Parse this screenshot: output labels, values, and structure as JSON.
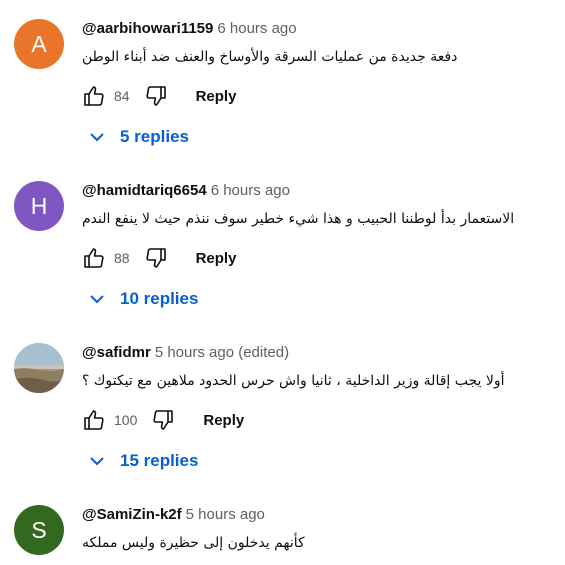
{
  "comments": [
    {
      "avatar_letter": "A",
      "avatar_color": "#e8752a",
      "author": "@aarbihowari1159",
      "time": "6 hours ago",
      "text": "دفعة جديدة من عمليات السرقة  والأوساخ والعنف ضد أبناء الوطن",
      "likes": "84",
      "reply_label": "Reply",
      "replies_label": "5 replies"
    },
    {
      "avatar_letter": "H",
      "avatar_color": "#7e57c2",
      "author": "@hamidtariq6654",
      "time": "6 hours ago",
      "text": "الاستعمار بدأ لوطننا الحبيب و هذا شيء خطير سوف ننذم حيث لا ينفع الندم",
      "likes": "88",
      "reply_label": "Reply",
      "replies_label": "10 replies"
    },
    {
      "avatar_letter": "",
      "avatar_color": "#a89a80",
      "author": "@safidmr",
      "time": "5 hours ago (edited)",
      "text": "أولا يجب إقالة وزير الداخلية ، ثانيا واش حرس الحدود ملاهين مع تيكتوك ؟",
      "likes": "100",
      "reply_label": "Reply",
      "replies_label": "15 replies"
    },
    {
      "avatar_letter": "S",
      "avatar_color": "#33691e",
      "author": "@SamiZin-k2f",
      "time": "5 hours ago",
      "text": "كأنهم يدخلون إلى حظيرة وليس مملكه"
    }
  ],
  "icons": {
    "like": "thumbs-up-icon",
    "dislike": "thumbs-down-icon",
    "expand": "chevron-down-icon"
  },
  "colors": {
    "link_blue": "#065fd4",
    "secondary_text": "#606060"
  }
}
